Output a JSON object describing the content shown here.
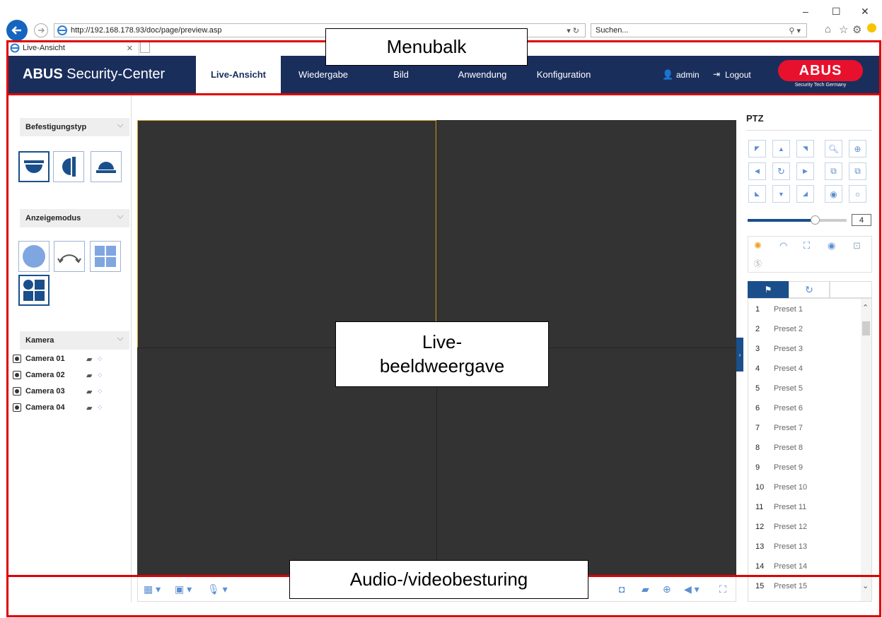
{
  "browser": {
    "url": "http://192.168.178.93/doc/page/preview.asp",
    "search_placeholder": "Suchen...",
    "tab_title": "Live-Ansicht",
    "minimize": "–",
    "maximize": "☐",
    "close": "✕"
  },
  "header": {
    "brand_bold": "ABUS",
    "brand_rest": " Security-Center",
    "nav": [
      "Live-Ansicht",
      "Wiedergabe",
      "Bild",
      "Anwendung",
      "Konfiguration"
    ],
    "active_nav": "Live-Ansicht",
    "user": "admin",
    "logout": "Logout",
    "logo_text": "ABUS",
    "logo_tagline": "Security Tech Germany"
  },
  "left_panel": {
    "mount_type_label": "Befestigungstyp",
    "display_mode_label": "Anzeigemodus",
    "camera_label": "Kamera",
    "cameras": [
      "Camera 01",
      "Camera 02",
      "Camera 03",
      "Camera 04"
    ]
  },
  "ptz": {
    "title": "PTZ",
    "speed_value": "4",
    "speed_level": 0.68,
    "presets": [
      {
        "num": "1",
        "name": "Preset 1"
      },
      {
        "num": "2",
        "name": "Preset 2"
      },
      {
        "num": "3",
        "name": "Preset 3"
      },
      {
        "num": "4",
        "name": "Preset 4"
      },
      {
        "num": "5",
        "name": "Preset 5"
      },
      {
        "num": "6",
        "name": "Preset 6"
      },
      {
        "num": "7",
        "name": "Preset 7"
      },
      {
        "num": "8",
        "name": "Preset 8"
      },
      {
        "num": "9",
        "name": "Preset 9"
      },
      {
        "num": "10",
        "name": "Preset 10"
      },
      {
        "num": "11",
        "name": "Preset 11"
      },
      {
        "num": "12",
        "name": "Preset 12"
      },
      {
        "num": "13",
        "name": "Preset 13"
      },
      {
        "num": "14",
        "name": "Preset 14"
      },
      {
        "num": "15",
        "name": "Preset 15"
      }
    ]
  },
  "annotations": {
    "menubar": "Menubalk",
    "live_view_line1": "Live-",
    "live_view_line2": "beeldweergave",
    "controls": "Audio-/videobesturing"
  },
  "colors": {
    "header_bg": "#1a2e5c",
    "accent_blue": "#1a4f8b",
    "icon_blue": "#5b8fd1",
    "video_bg": "#333333",
    "selected_cell": "#d9a520",
    "annotation_red": "#e00000"
  }
}
